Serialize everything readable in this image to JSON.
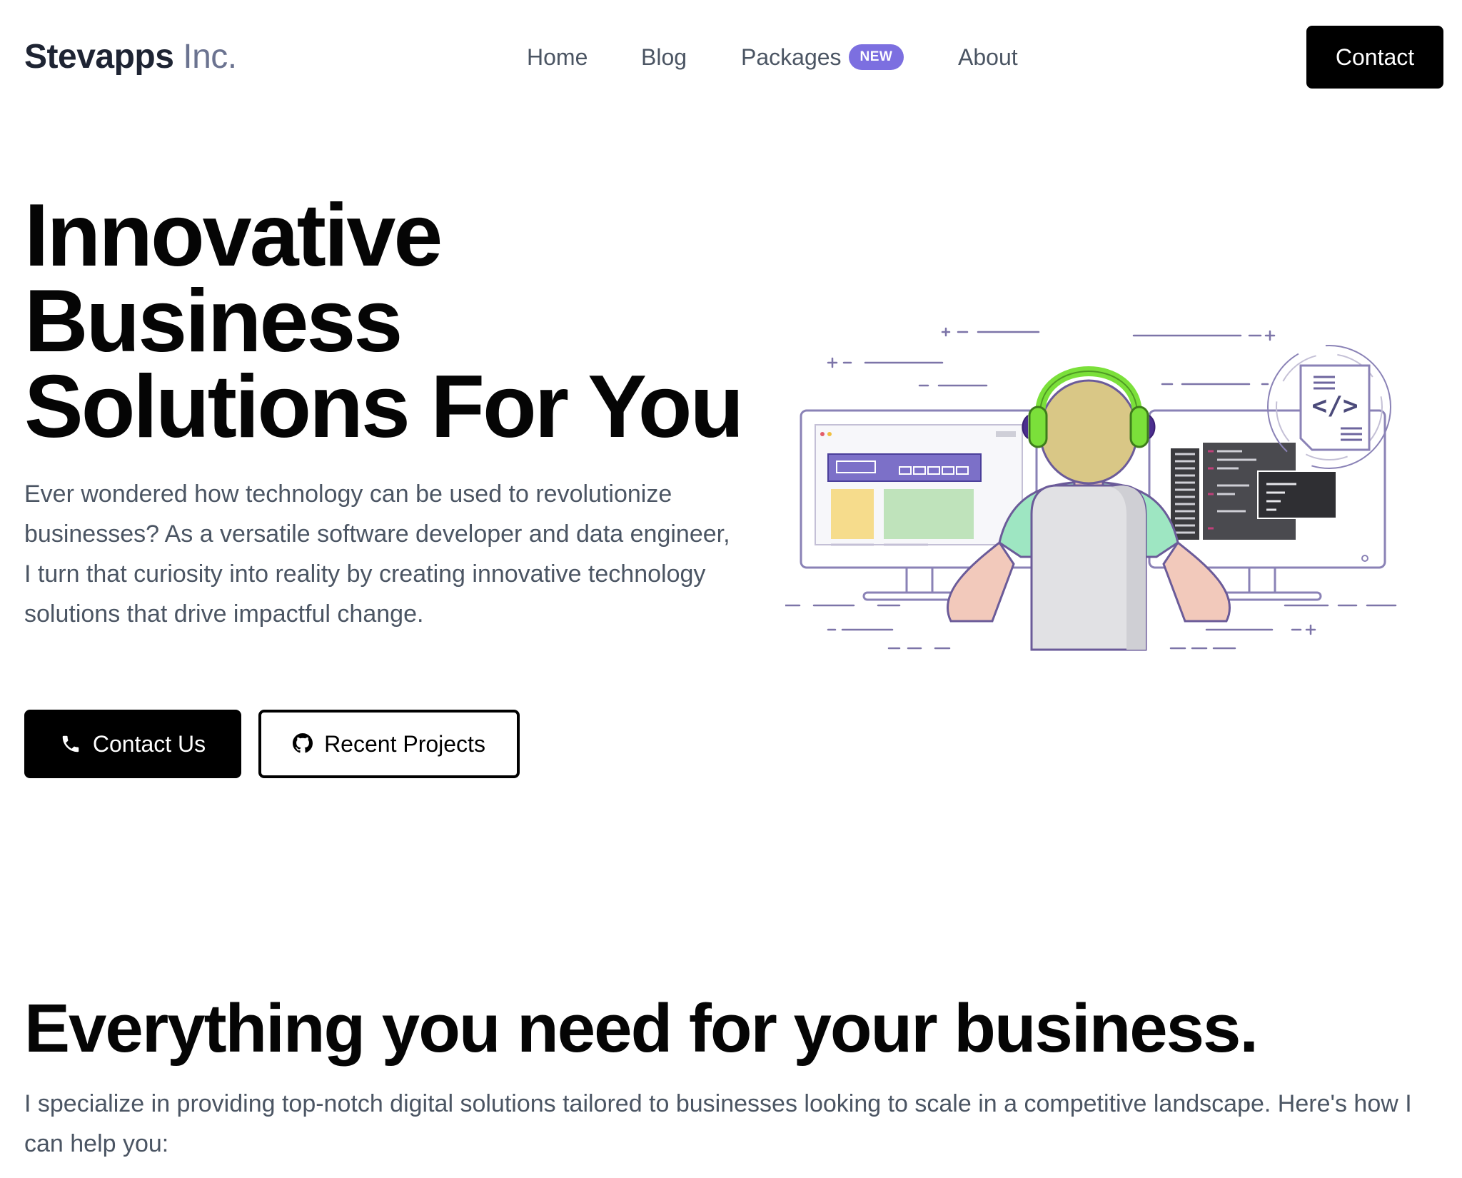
{
  "header": {
    "logo_brand": "Stevapps",
    "logo_suffix": " Inc.",
    "nav": {
      "home": "Home",
      "blog": "Blog",
      "packages": "Packages",
      "packages_badge": "NEW",
      "about": "About"
    },
    "contact_label": "Contact"
  },
  "hero": {
    "title": "Innovative Business Solutions For You",
    "description": "Ever wondered how technology can be used to revolutionize businesses? As a versatile software developer and data engineer, I turn that curiosity into reality by creating innovative technology solutions that drive impactful change.",
    "primary_button": {
      "label": "Contact Us",
      "icon": "phone-icon"
    },
    "secondary_button": {
      "label": "Recent Projects",
      "icon": "github-icon"
    },
    "illustration": {
      "code_symbol": "</>"
    }
  },
  "section": {
    "title": "Everything you need for your business.",
    "description": "I specialize in providing top-notch digital solutions tailored to businesses looking to scale in a competitive landscape. Here's how I can help you:"
  },
  "colors": {
    "accent_badge": "#7c6fe0",
    "primary_button": "#000000",
    "body_text": "#4b5563",
    "headphones": "#7be03a"
  }
}
